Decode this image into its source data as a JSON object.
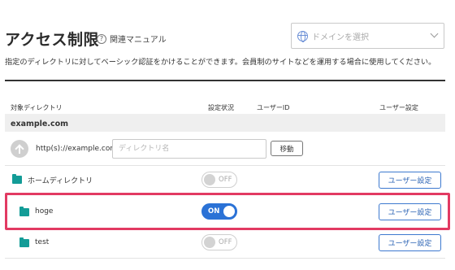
{
  "page": {
    "title": "アクセス制限",
    "help_label": "関連マニュアル",
    "help_icon_glyph": "?",
    "description": "指定のディレクトリに対してベーシック認証をかけることができます。会員制のサイトなどを運用する場合に使用してください。"
  },
  "domain_select": {
    "placeholder": "ドメインを選択",
    "icon": "globe-icon"
  },
  "table": {
    "headers": {
      "directory": "対象ディレクトリ",
      "status": "設定状況",
      "user_id": "ユーザーID",
      "user_settings": "ユーザー設定"
    },
    "domain": "example.com",
    "new_row": {
      "url_prefix": "http(s)://example.com/",
      "input_placeholder": "ディレクトリ名",
      "move_label": "移動"
    },
    "rows": [
      {
        "name": "ホームディレクトリ",
        "toggle_label": "OFF",
        "enabled": false,
        "button_label": "ユーザー設定"
      },
      {
        "name": "hoge",
        "toggle_label": "ON",
        "enabled": true,
        "button_label": "ユーザー設定"
      },
      {
        "name": "test",
        "toggle_label": "OFF",
        "enabled": false,
        "button_label": "ユーザー設定"
      }
    ]
  },
  "colors": {
    "accent": "#2b72d6",
    "folder": "#139c97",
    "highlight": "#e23a62"
  }
}
